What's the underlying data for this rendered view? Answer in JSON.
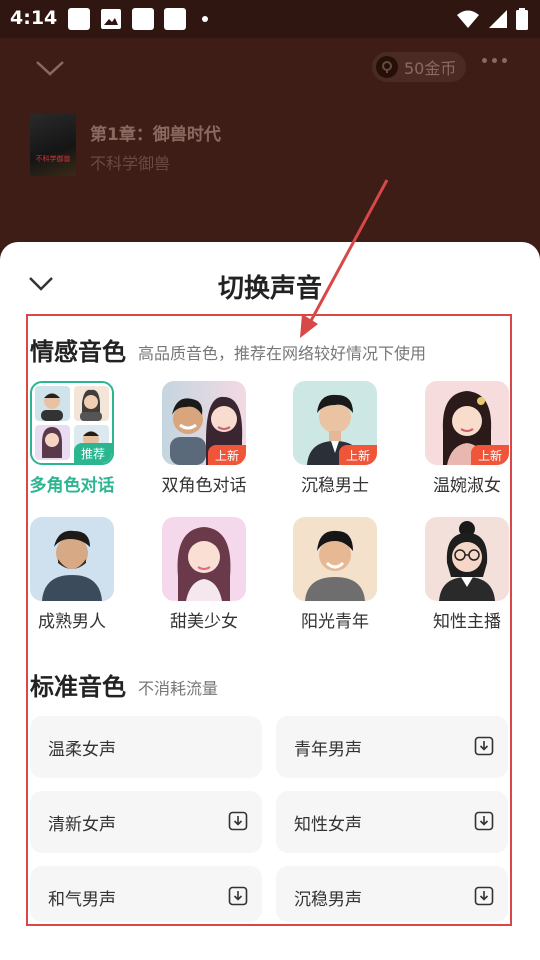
{
  "status": {
    "time": "4:14"
  },
  "player": {
    "coins_label": "50金币",
    "chapter_title": "第1章：御兽时代",
    "author": "不科学御兽",
    "cover_text": "不科学御兽"
  },
  "sheet": {
    "title": "切换声音",
    "emotional": {
      "title": "情感音色",
      "subtitle": "高品质音色，推荐在网络较好情况下使用",
      "voices": [
        {
          "label": "多角色对话",
          "badge": "推荐",
          "badge_color": "#2bb590",
          "selected": true
        },
        {
          "label": "双角色对话",
          "badge": "上新",
          "badge_color": "#f0553a"
        },
        {
          "label": "沉稳男士",
          "badge": "上新",
          "badge_color": "#f0553a"
        },
        {
          "label": "温婉淑女",
          "badge": "上新",
          "badge_color": "#f0553a"
        },
        {
          "label": "成熟男人"
        },
        {
          "label": "甜美少女"
        },
        {
          "label": "阳光青年"
        },
        {
          "label": "知性主播"
        }
      ]
    },
    "standard": {
      "title": "标准音色",
      "subtitle": "不消耗流量",
      "voices": [
        {
          "label": "温柔女声",
          "download": false
        },
        {
          "label": "青年男声",
          "download": true
        },
        {
          "label": "清新女声",
          "download": true
        },
        {
          "label": "知性女声",
          "download": true
        },
        {
          "label": "和气男声",
          "download": true
        },
        {
          "label": "沉稳男声",
          "download": true
        }
      ]
    }
  },
  "colors": {
    "accent": "#2bb590",
    "new_badge": "#f0553a",
    "annotation": "#d84848"
  }
}
